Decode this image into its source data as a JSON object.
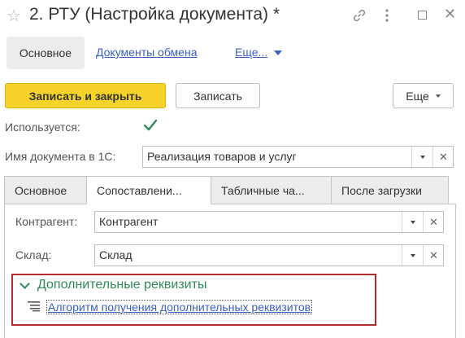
{
  "window": {
    "title": "2. РТУ (Настройка документа) *"
  },
  "nav": {
    "tabs": [
      {
        "label": "Основное"
      },
      {
        "label": "Документы обмена"
      },
      {
        "label": "Еще..."
      }
    ]
  },
  "toolbar": {
    "save_close_label": "Записать и закрыть",
    "save_label": "Записать",
    "more_label": "Еще"
  },
  "form": {
    "used_label": "Используется:",
    "used_checked": true,
    "docname_label": "Имя документа в 1С:",
    "docname_value": "Реализация товаров и услуг"
  },
  "tabs": [
    {
      "label": "Основное"
    },
    {
      "label": "Сопоставлени..."
    },
    {
      "label": "Табличные ча..."
    },
    {
      "label": "После загрузки"
    }
  ],
  "mapping": {
    "counterparty_label": "Контрагент:",
    "counterparty_value": "Контрагент",
    "warehouse_label": "Склад:",
    "warehouse_value": "Склад"
  },
  "group": {
    "title": "Дополнительные реквизиты",
    "link_label": "Алгоритм получения дополнительных реквизитов"
  },
  "colors": {
    "primary_button": "#f6d32a",
    "link": "#3a5fbf",
    "group_title": "#2e8b57",
    "highlight_border": "#b52b2b",
    "check": "#2e8b57"
  }
}
